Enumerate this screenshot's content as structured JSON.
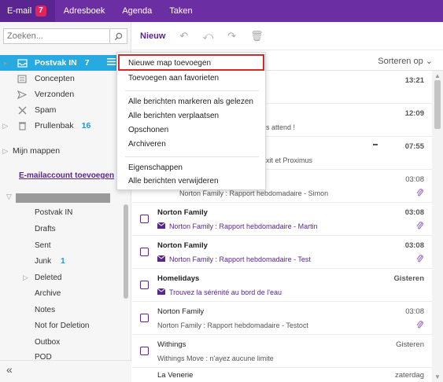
{
  "topnav": {
    "tabs": [
      {
        "label": "E-mail",
        "badge": "7"
      },
      {
        "label": "Adresboek"
      },
      {
        "label": "Agenda"
      },
      {
        "label": "Taken"
      }
    ]
  },
  "sidebar": {
    "search_placeholder": "Zoeken...",
    "folders": [
      {
        "label": "Postvak IN",
        "count": "7"
      },
      {
        "label": "Concepten"
      },
      {
        "label": "Verzonden"
      },
      {
        "label": "Spam"
      },
      {
        "label": "Prullenbak",
        "count": "16"
      },
      {
        "label": "Mijn mappen"
      }
    ],
    "add_account": "E-mailaccount toevoegen",
    "subfolders": [
      {
        "label": "Postvak IN"
      },
      {
        "label": "Drafts"
      },
      {
        "label": "Sent"
      },
      {
        "label": "Junk",
        "count": "1"
      },
      {
        "label": "Deleted"
      },
      {
        "label": "Archive"
      },
      {
        "label": "Notes"
      },
      {
        "label": "Not for Deletion"
      },
      {
        "label": "Outbox"
      },
      {
        "label": "POD"
      }
    ]
  },
  "toolbar": {
    "new_label": "Nieuw"
  },
  "sort_label": "Sorteren op",
  "context_menu": {
    "items": [
      "Nieuwe map toevoegen",
      "Toevoegen aan favorieten",
      "Alle berichten markeren als gelezen",
      "Alle berichten verplaatsen",
      "Opschonen",
      "Archiveren",
      "Eigenschappen",
      "Alle berichten verwijderen"
    ]
  },
  "mails": [
    {
      "from": "",
      "subject": "",
      "time": "13:21"
    },
    {
      "from": "",
      "subject": "s attend !",
      "time": "12:09"
    },
    {
      "from": "",
      "subject": "xit et Proximus",
      "time": "07:55"
    },
    {
      "from": "",
      "subject": "Norton Family : Rapport hebdomadaire - Simon",
      "time": "03:08"
    },
    {
      "from": "Norton Family",
      "subject": "Norton Family : Rapport hebdomadaire - Martin",
      "time": "03:08"
    },
    {
      "from": "Norton Family",
      "subject": "Norton Family : Rapport hebdomadaire - Test",
      "time": "03:08"
    },
    {
      "from": "Homelidays",
      "subject": "Trouvez la sérénité au bord de l'eau",
      "time": "Gisteren"
    },
    {
      "from": "Norton Family",
      "subject": "Norton Family : Rapport hebdomadaire - Testoct",
      "time": "03:08"
    },
    {
      "from": "Withings",
      "subject": "Withings Move : n'ayez aucune limite",
      "time": "Gisteren"
    },
    {
      "from": "La Venerie",
      "subject": "",
      "time": "zaterdag"
    }
  ],
  "colors": {
    "brand": "#6b2fa3",
    "accent": "#27a9e1",
    "highlight": "#d62828"
  }
}
